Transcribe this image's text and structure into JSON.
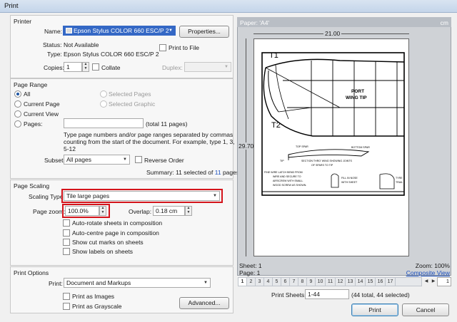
{
  "window": {
    "title": "Print"
  },
  "printer": {
    "group_title": "Printer",
    "name_label": "Name:",
    "name_value": "Epson Stylus COLOR 660 ESC/P 2",
    "properties_button": "Properties...",
    "status_label": "Status:",
    "status_value": "Not Available",
    "type_label": "Type:",
    "type_value": "Epson Stylus COLOR 660 ESC/P 2",
    "print_to_file": "Print to File",
    "copies_label": "Copies:",
    "copies_value": "1",
    "collate": "Collate",
    "duplex_label": "Duplex:"
  },
  "page_range": {
    "group_title": "Page Range",
    "all": "All",
    "current_page": "Current Page",
    "current_view": "Current View",
    "pages": "Pages:",
    "selected_pages": "Selected Pages",
    "selected_graphic": "Selected Graphic",
    "total_pages": "(total 11 pages)",
    "help_text_1": "Type page numbers and/or page ranges separated by commas",
    "help_text_2": "counting from the start of the document. For example, type 1, 3,",
    "help_text_3": "5-12",
    "subset_label": "Subset:",
    "subset_value": "All pages",
    "reverse_order": "Reverse Order",
    "summary_prefix": "Summary: 11 selected of ",
    "summary_count": "11",
    "summary_suffix": " pages"
  },
  "page_scaling": {
    "group_title": "Page Scaling",
    "scaling_type_label": "Scaling Type:",
    "scaling_type_value": "Tile large pages",
    "page_zoom_label": "Page zoom:",
    "page_zoom_value": "100.0%",
    "overlap_label": "Overlap:",
    "overlap_value": "0.18 cm",
    "auto_rotate": "Auto-rotate sheets in composition",
    "auto_centre": "Auto-centre page in composition",
    "show_cut_marks": "Show cut marks on sheets",
    "show_labels": "Show labels on sheets"
  },
  "print_options": {
    "group_title": "Print Options",
    "print_label": "Print:",
    "print_value": "Document and Markups",
    "print_as_images": "Print as Images",
    "print_as_grayscale": "Print as Grayscale",
    "advanced_button": "Advanced..."
  },
  "preview": {
    "paper_label": "Paper: 'A4'",
    "unit": "cm",
    "width_dim": "21.00",
    "height_dim": "29.70",
    "sheet_label": "Sheet: 1",
    "page_label": "Page: 1",
    "zoom_label": "Zoom: 100%",
    "composite_view": "Composite View",
    "tabs": [
      "1",
      "2",
      "3",
      "4",
      "5",
      "6",
      "7",
      "8",
      "9",
      "10",
      "11",
      "12",
      "13",
      "14",
      "15",
      "16",
      "17"
    ],
    "sheet_page_input": "1",
    "print_sheets_label": "Print Sheets:",
    "print_sheets_value": "1-44",
    "print_sheets_summary": "(44 total, 44 selected)",
    "drawing_text": {
      "t1": "T1",
      "t2": "T2",
      "port": "PORT",
      "wing_tip": "WING TIP",
      "top_spar": "TOP SPAR",
      "bottom_spar": "BOTTOM SPAR",
      "tip": "TIP",
      "section": "SECTION THRO' WING SHOWING JOINTS",
      "of_spars": "OF SPARS TO TIP",
      "fine_wire": "FINE WIRE LATCH BEND FROM",
      "wire_secure": "WIRE AND SECURE TO",
      "airscrew": "AIRSCREW WITH SMALL",
      "wood_screw": "WOOD SCREW AS SHOWN.",
      "fill_nose": "FILL IN NOSE",
      "with_sheet": "WITH SHEET",
      "tyre": "TYRE",
      "trail": "TRAIL"
    }
  },
  "buttons": {
    "print": "Print",
    "cancel": "Cancel"
  },
  "colors": {
    "highlight_red": "#d4141b",
    "link_blue": "#1a4fbf",
    "selection_blue": "#3468c5"
  }
}
